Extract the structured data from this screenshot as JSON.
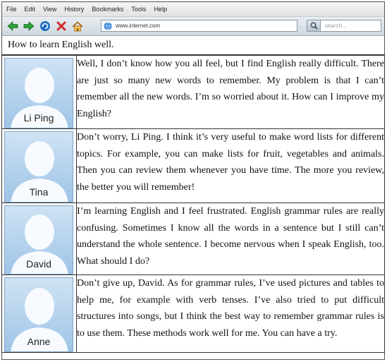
{
  "menu": [
    "File",
    "Edit",
    "View",
    "History",
    "Bookmarks",
    "Tools",
    "Help"
  ],
  "toolbar": {
    "url": "www.internet.com",
    "search_placeholder": "search..."
  },
  "page": {
    "title": "How to learn English well."
  },
  "posts": [
    {
      "name": "Li Ping",
      "text": "Well, I don’t know how you all feel, but I find English really difficult. There are just so many new words to remember. My problem is that I can’t remember all the new words. I’m so worried about it. How can I improve my English?"
    },
    {
      "name": "Tina",
      "text": "Don’t worry, Li Ping. I think it’s very useful to make word lists for different topics. For example, you can make lists for fruit, vegetables and animals. Then you can review them whenever you have time. The more you review, the better you will remember!"
    },
    {
      "name": "David",
      "text": "I’m learning English and I feel frustrated. English grammar rules are really confusing. Sometimes I know all the words in a sentence but I still can’t understand the whole sentence. I become nervous when I speak English, too. What should I do?"
    },
    {
      "name": "Anne",
      "text": "Don’t give up, David. As for grammar rules, I’ve used pictures and tables to help me, for example with verb tenses. I’ve also tried to put difficult structures into songs, but I think the best way to remember grammar rules is to use them. These methods work well for me. You can have a try."
    }
  ],
  "colors": {
    "back": "#2e9e3a",
    "forward": "#2e9e3a",
    "refresh": "#1f6fbf",
    "stop": "#d22b2b",
    "home": "#d98b1f"
  },
  "icons": [
    "back-arrow-icon",
    "forward-arrow-icon",
    "refresh-icon",
    "stop-icon",
    "home-icon",
    "globe-icon",
    "search-icon",
    "person-silhouette-icon"
  ]
}
